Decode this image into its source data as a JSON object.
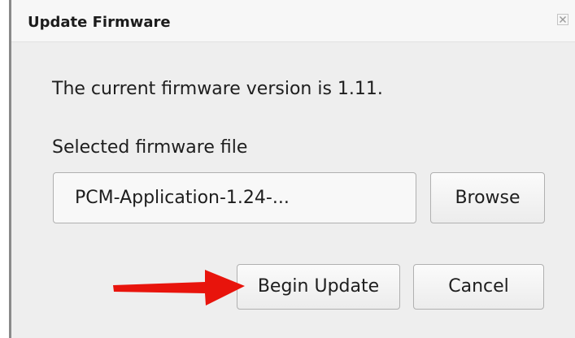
{
  "dialog": {
    "title": "Update Firmware",
    "close_icon": "close-icon"
  },
  "content": {
    "version_text": "The current firmware version is 1.11.",
    "file_label": "Selected firmware file",
    "file_value": "PCM-Application-1.24-..."
  },
  "buttons": {
    "browse_label": "Browse",
    "begin_label": "Begin Update",
    "cancel_label": "Cancel"
  },
  "annotation": {
    "arrow_icon": "red-arrow-icon",
    "arrow_color": "#e8140c"
  },
  "colors": {
    "panel_background": "#eeeeee",
    "title_background": "#f7f7f7"
  }
}
